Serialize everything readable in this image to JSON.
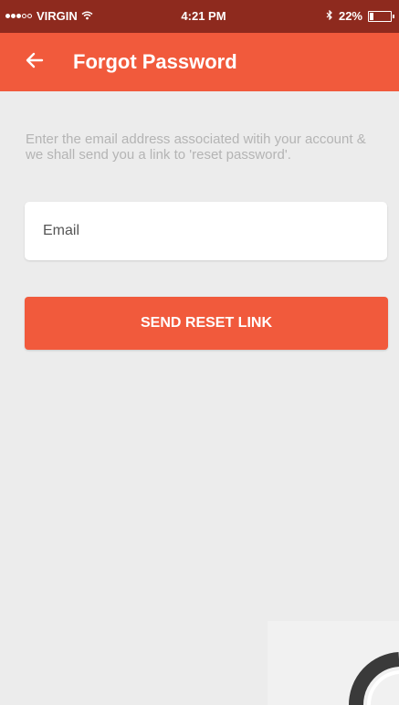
{
  "status_bar": {
    "carrier": "VIRGIN",
    "time": "4:21 PM",
    "battery": "22%",
    "battery_level": 0.22,
    "icons": [
      "signal-dots-icon",
      "wifi-icon",
      "bluetooth-icon",
      "battery-icon"
    ]
  },
  "app_bar": {
    "title": "Forgot Password",
    "back_icon": "arrow-left-icon"
  },
  "form": {
    "instructions": "Enter the email address associated witih your account & we shall send you a link to 'reset password'.",
    "email_placeholder": "Email",
    "email_value": "",
    "submit_label": "SEND RESET LINK"
  },
  "colors": {
    "status_bar_bg": "#8e2a1e",
    "accent": "#f15a3c",
    "background": "#ececec",
    "instruction_text": "#b4b4b4"
  }
}
